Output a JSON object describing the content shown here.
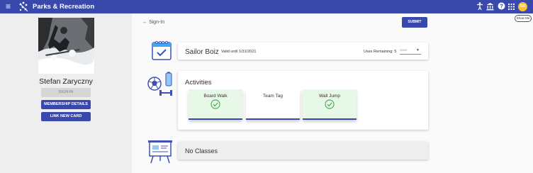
{
  "topbar": {
    "app_title": "Parks & Recreation",
    "avatar_initials": "SW",
    "tooltip": "Show Me",
    "color": "#3949ab"
  },
  "sidebar": {
    "user_name": "Stefan Zaryczny",
    "sign_in_label": "SIGN-IN",
    "membership_details_label": "MEMBERSHIP DETAILS",
    "link_new_card_label": "LINK NEW CARD"
  },
  "header": {
    "back_label": "Sign-In",
    "submit_label": "SUBMIT"
  },
  "membership": {
    "name": "Sailor Boiz",
    "valid_until": "Valid until 1/31/2021",
    "uses_remaining_label": "Uses Remaining: 5",
    "uses_placeholder": "Uses"
  },
  "activities": {
    "title": "Activities",
    "items": [
      {
        "label": "Board Walk",
        "checked": true
      },
      {
        "label": "Team Tag",
        "checked": false
      },
      {
        "label": "Wall Jump",
        "checked": true
      }
    ]
  },
  "classes": {
    "title": "No Classes"
  },
  "colors": {
    "primary": "#3949ab",
    "check_green": "#4caf50",
    "tile_done_bg": "#e8f8e8",
    "avatar": "#fbc02d"
  }
}
